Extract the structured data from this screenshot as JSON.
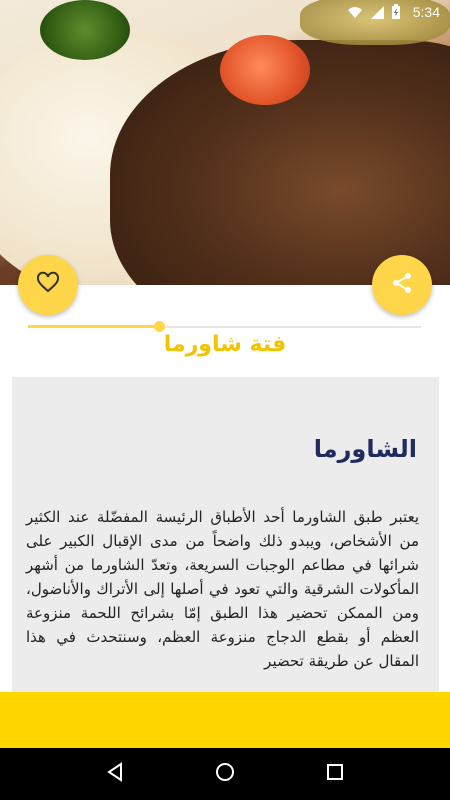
{
  "status_bar": {
    "time": "5:34",
    "icons": [
      "wifi-icon",
      "signal-icon",
      "battery-charging-icon"
    ]
  },
  "hero": {
    "image": "shawarma-plate-photo"
  },
  "buttons": {
    "favorite_icon": "heart-outline-icon",
    "share_icon": "share-icon"
  },
  "recipe": {
    "title": "فتة شاورما"
  },
  "article": {
    "heading": "الشاورما",
    "body": "يعتبر طبق الشاورما أحد الأطباق الرئيسة المفضّلة عند الكثير من الأشخاص، ويبدو ذلك واضحاً من مدى الإقبال الكبير على شرائها في مطاعم الوجبات السريعة، وتعدّ الشاورما من أشهر المأكولات الشرقية والتي تعود في أصلها إلى الأتراك والأناضول، ومن الممكن تحضير هذا الطبق إمّا بشرائح اللحمة منزوعة العظم أو بقطع الدجاج منزوعة العظم، وسنتحدث في هذا المقال عن طريقة تحضير"
  },
  "navigation": {
    "icons": [
      "back-icon",
      "home-icon",
      "recents-icon"
    ]
  },
  "colors": {
    "accent": "#ffd54a",
    "title": "#f2c400",
    "heading": "#1f2a5e",
    "card_background": "#ececec",
    "bottom_bar": "#ffd600"
  }
}
